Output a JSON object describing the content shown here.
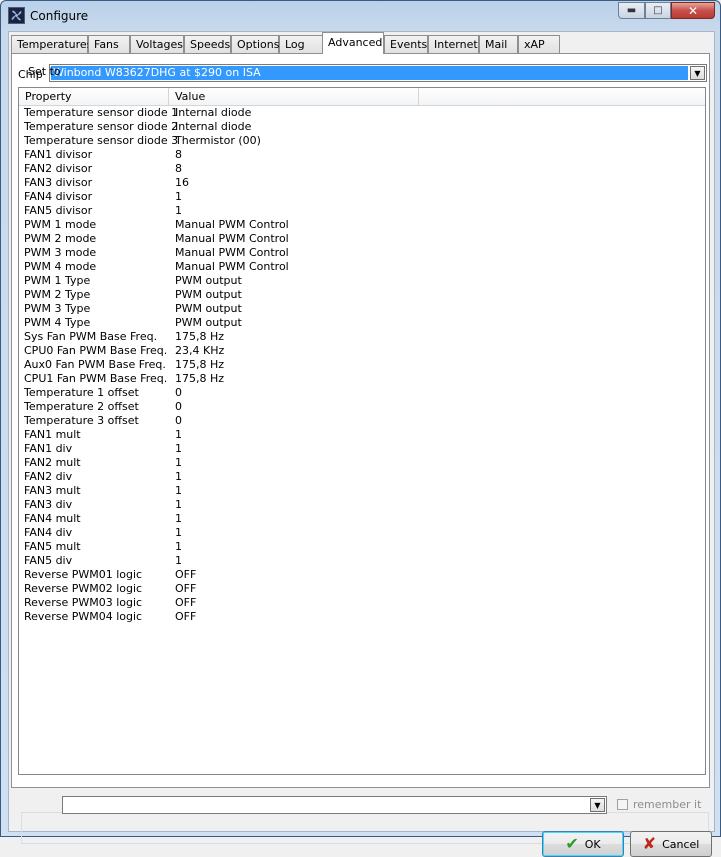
{
  "window": {
    "title": "Configure"
  },
  "tabs": [
    "Temperatures",
    "Fans",
    "Voltages",
    "Speeds",
    "Options",
    "Log",
    "Advanced",
    "Events",
    "Internet",
    "Mail",
    "xAP"
  ],
  "active_tab": "Advanced",
  "chip": {
    "label": "Chip",
    "value": "Winbond W83627DHG at $290 on ISA"
  },
  "table": {
    "columns": [
      "Property",
      "Value"
    ],
    "rows": [
      [
        "Temperature sensor diode 1",
        "Internal diode"
      ],
      [
        "Temperature sensor diode 2",
        "Internal diode"
      ],
      [
        "Temperature sensor diode 3",
        "Thermistor (00)"
      ],
      [
        "FAN1 divisor",
        "8"
      ],
      [
        "FAN2 divisor",
        "8"
      ],
      [
        "FAN3 divisor",
        "16"
      ],
      [
        "FAN4 divisor",
        "1"
      ],
      [
        "FAN5 divisor",
        "1"
      ],
      [
        "PWM 1 mode",
        "Manual PWM Control"
      ],
      [
        "PWM 2 mode",
        "Manual PWM Control"
      ],
      [
        "PWM 3 mode",
        "Manual PWM Control"
      ],
      [
        "PWM 4 mode",
        "Manual PWM Control"
      ],
      [
        "PWM 1 Type",
        "PWM output"
      ],
      [
        "PWM 2 Type",
        "PWM output"
      ],
      [
        "PWM 3 Type",
        "PWM output"
      ],
      [
        "PWM 4 Type",
        "PWM output"
      ],
      [
        "Sys Fan PWM Base Freq.",
        "175,8 Hz"
      ],
      [
        "CPU0 Fan PWM Base Freq.",
        "23,4 KHz"
      ],
      [
        "Aux0 Fan PWM Base Freq.",
        "175,8 Hz"
      ],
      [
        "CPU1 Fan PWM Base Freq.",
        "175,8 Hz"
      ],
      [
        "Temperature 1 offset",
        "0"
      ],
      [
        "Temperature 2 offset",
        "0"
      ],
      [
        "Temperature 3 offset",
        "0"
      ],
      [
        "FAN1 mult",
        "1"
      ],
      [
        "FAN1 div",
        "1"
      ],
      [
        "FAN2 mult",
        "1"
      ],
      [
        "FAN2 div",
        "1"
      ],
      [
        "FAN3 mult",
        "1"
      ],
      [
        "FAN3 div",
        "1"
      ],
      [
        "FAN4 mult",
        "1"
      ],
      [
        "FAN4 div",
        "1"
      ],
      [
        "FAN5 mult",
        "1"
      ],
      [
        "FAN5 div",
        "1"
      ],
      [
        "Reverse PWM01 logic",
        "OFF"
      ],
      [
        "Reverse PWM02 logic",
        "OFF"
      ],
      [
        "Reverse PWM03 logic",
        "OFF"
      ],
      [
        "Reverse PWM04 logic",
        "OFF"
      ]
    ]
  },
  "set_to": {
    "label": "Set to",
    "value": ""
  },
  "remember": {
    "label": "remember it",
    "checked": false
  },
  "buttons": {
    "ok": "OK",
    "cancel": "Cancel"
  },
  "icons": {
    "ok": "check-icon",
    "cancel": "x-icon",
    "app": "fan-icon"
  },
  "colors": {
    "selection": "#3399ff",
    "ok_icon": "#2a9d2a",
    "cancel_icon": "#c0281f"
  }
}
